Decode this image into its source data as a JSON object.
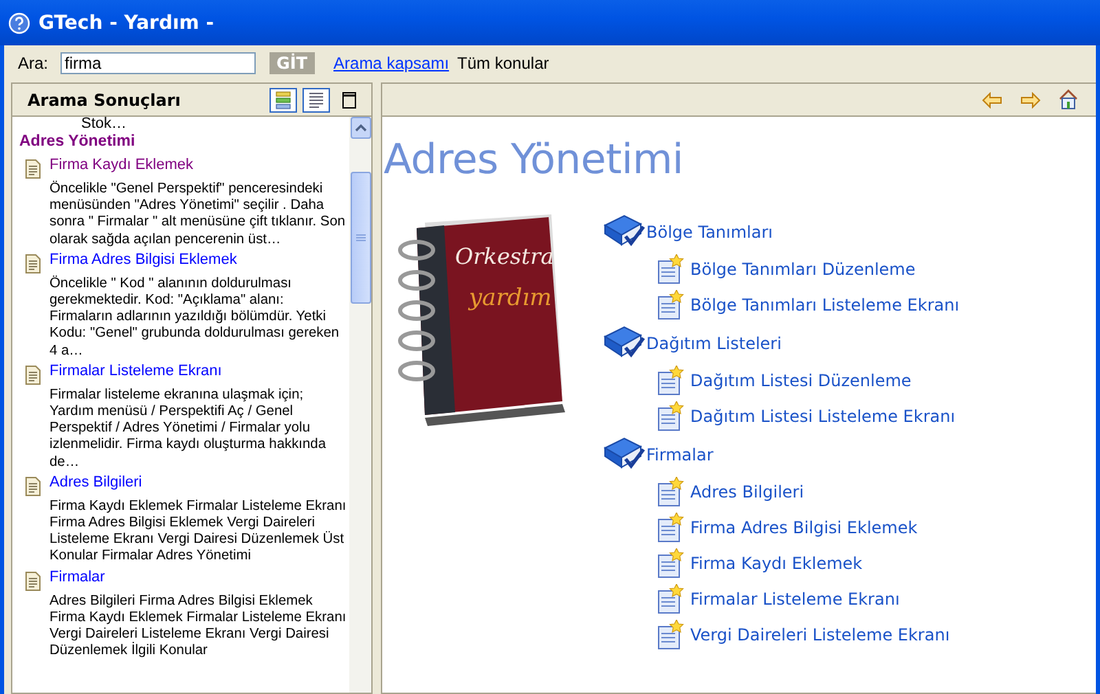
{
  "window": {
    "title": "GTech - Yardım -"
  },
  "search": {
    "label": "Ara:",
    "value": "firma",
    "go_button": "GİT",
    "scope_link": "Arama kapsamı",
    "scope_value": "Tüm konular"
  },
  "results_pane": {
    "title": "Arama Sonuçları",
    "tail_text": "Stok…",
    "group": "Adres Yönetimi",
    "results": [
      {
        "title": "Firma Kaydı Eklemek",
        "visited": true,
        "snippet": "Öncelikle \"Genel Perspektif\" penceresindeki menüsünden \"Adres Yönetimi\" seçilir . Daha sonra \" Firmalar \" alt menüsüne çift tıklanır. Son olarak sağda açılan pencerenin üst…"
      },
      {
        "title": "Firma Adres Bilgisi Eklemek",
        "visited": false,
        "snippet": "Öncelikle \" Kod \" alanının doldurulması gerekmektedir. Kod: \"Açıklama\" alanı: Firmaların adlarının yazıldığı bölümdür. Yetki Kodu: \"Genel\" grubunda doldurulması gereken 4 a…"
      },
      {
        "title": "Firmalar Listeleme Ekranı",
        "visited": false,
        "snippet": "Firmalar listeleme ekranına ulaşmak için; Yardım menüsü / Perspektifi Aç / Genel Perspektif / Adres Yönetimi / Firmalar yolu izlenmelidir. Firma kaydı oluşturma hakkında de…"
      },
      {
        "title": "Adres Bilgileri",
        "visited": false,
        "snippet": "Firma Kaydı Eklemek Firmalar Listeleme Ekranı Firma Adres Bilgisi Eklemek Vergi Daireleri Listeleme Ekranı Vergi Dairesi Düzenlemek Üst Konular Firmalar Adres Yönetimi"
      },
      {
        "title": "Firmalar",
        "visited": false,
        "snippet": "Adres Bilgileri Firma Adres Bilgisi Eklemek Firma Kaydı Eklemek Firmalar Listeleme Ekranı Vergi Daireleri Listeleme Ekranı Vergi Dairesi Düzenlemek İlgili Konular"
      }
    ]
  },
  "content": {
    "heading": "Adres Yönetimi",
    "logo": {
      "line_1": "Orkestra",
      "line_2": "yardım"
    },
    "topics": [
      {
        "label": "Bölge Tanımları",
        "children": [
          {
            "label": "Bölge Tanımları Düzenleme"
          },
          {
            "label": "Bölge Tanımları Listeleme Ekranı"
          }
        ]
      },
      {
        "label": "Dağıtım Listeleri",
        "children": [
          {
            "label": "Dağıtım Listesi Düzenleme"
          },
          {
            "label": "Dağıtım Listesi Listeleme Ekranı"
          }
        ]
      },
      {
        "label": "Firmalar",
        "children": [
          {
            "label": "Adres Bilgileri"
          },
          {
            "label": "Firma Adres Bilgisi Eklemek"
          },
          {
            "label": "Firma Kaydı Eklemek"
          },
          {
            "label": "Firmalar Listeleme Ekranı"
          },
          {
            "label": "Vergi Daireleri Listeleme Ekranı"
          }
        ]
      }
    ]
  }
}
